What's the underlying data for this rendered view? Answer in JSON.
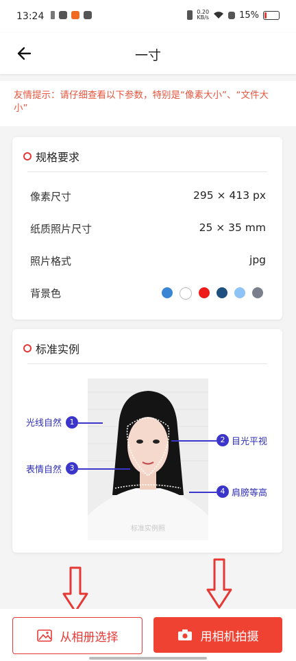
{
  "status_bar": {
    "time": "13:24",
    "net_speed_value": "0.20",
    "net_speed_unit": "KB/s",
    "battery": "15%"
  },
  "header": {
    "title": "一寸"
  },
  "notice": {
    "text": "友情提示：请仔细查看以下参数，特别是“像素大小”、“文件大小”"
  },
  "spec": {
    "title": "规格要求",
    "rows": [
      {
        "label": "像素尺寸",
        "value": "295 × 413 px"
      },
      {
        "label": "纸质照片尺寸",
        "value": "25 × 35 mm"
      },
      {
        "label": "照片格式",
        "value": "jpg"
      },
      {
        "label": "背景色",
        "value": ""
      }
    ],
    "bg_colors": [
      "#3a86d4",
      "#ffffff",
      "#ee1b1b",
      "#1f4f7f",
      "#8dc3f5",
      "#7a7f8e"
    ]
  },
  "example": {
    "title": "标准实例",
    "watermark": "标准实例照",
    "annotations": [
      {
        "num": "1",
        "label": "光线自然"
      },
      {
        "num": "2",
        "label": "目光平视"
      },
      {
        "num": "3",
        "label": "表情自然"
      },
      {
        "num": "4",
        "label": "肩膀等高"
      }
    ]
  },
  "buttons": {
    "album": "从相册选择",
    "camera": "用相机拍摄"
  },
  "colors": {
    "accent": "#f04233",
    "annotation": "#3b36c9"
  }
}
